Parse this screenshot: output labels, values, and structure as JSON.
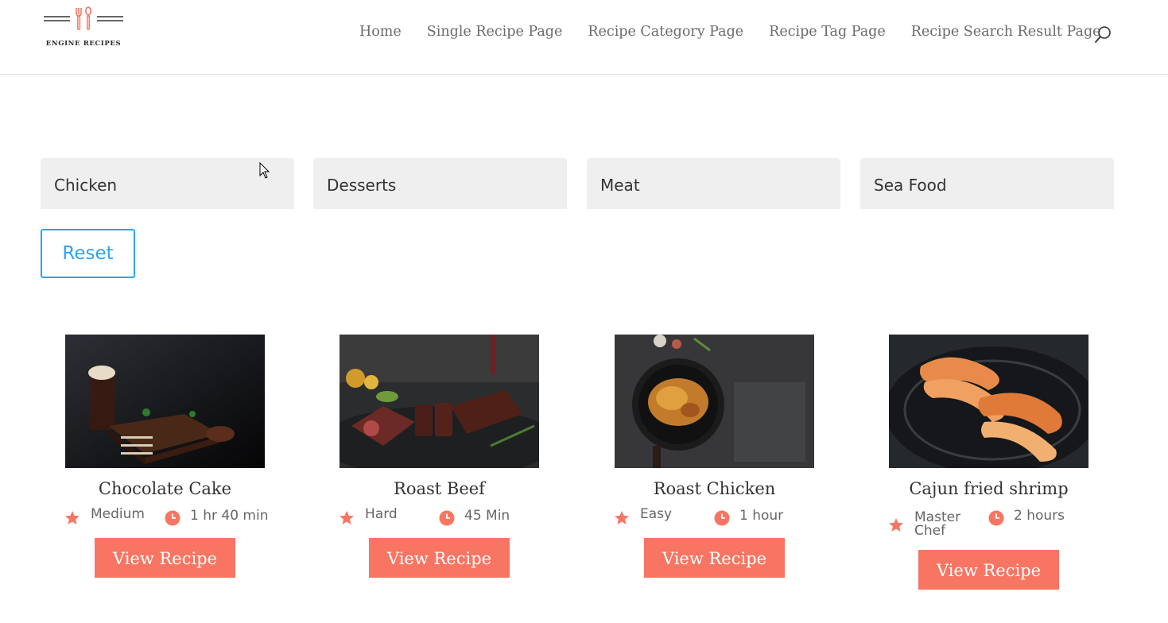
{
  "header": {
    "logo_text": "ENGINE RECIPES",
    "nav": [
      "Home",
      "Single Recipe Page",
      "Recipe Category Page",
      "Recipe Tag Page",
      "Recipe Search Result Page"
    ],
    "search_icon": "search-icon"
  },
  "filters": [
    "Chicken",
    "Desserts",
    "Meat",
    "Sea Food"
  ],
  "reset_label": "Reset",
  "recipes": [
    {
      "title": "Chocolate Cake",
      "difficulty": "Medium",
      "time": "1 hr 40 min",
      "button": "View Recipe"
    },
    {
      "title": "Roast Beef",
      "difficulty": "Hard",
      "time": "45 Min",
      "button": "View Recipe"
    },
    {
      "title": "Roast Chicken",
      "difficulty": "Easy",
      "time": "1 hour",
      "button": "View Recipe"
    },
    {
      "title": "Cajun fried shrimp",
      "difficulty": "Master Chef",
      "time": "2 hours",
      "button": "View Recipe"
    }
  ],
  "colors": {
    "accent": "#f77562",
    "link_blue": "#2ea3f2",
    "chip_bg": "#efefef"
  }
}
